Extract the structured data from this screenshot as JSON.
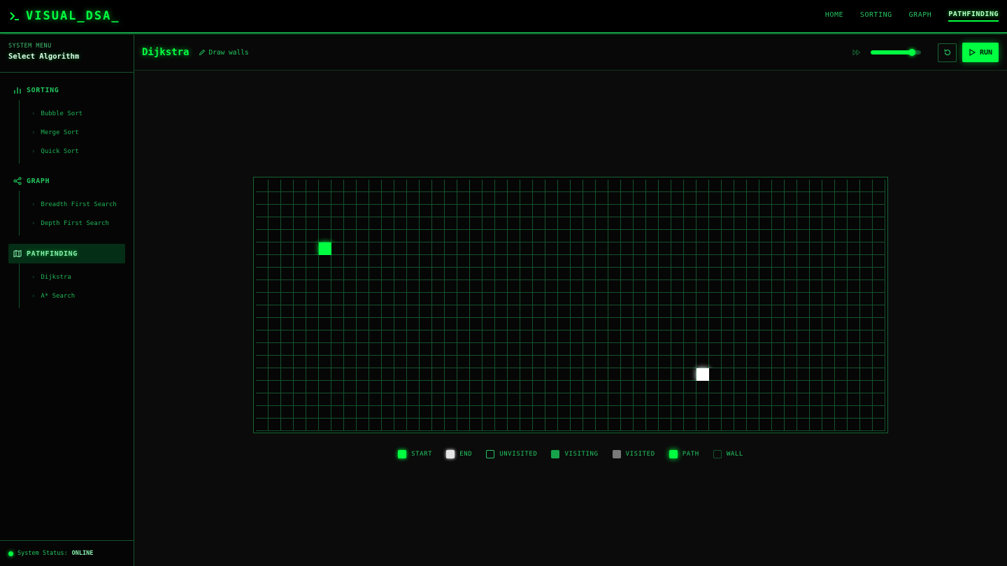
{
  "brand": {
    "text": "VISUAL_DSA_"
  },
  "topnav": [
    {
      "label": "HOME",
      "active": false
    },
    {
      "label": "SORTING",
      "active": false
    },
    {
      "label": "GRAPH",
      "active": false
    },
    {
      "label": "PATHFINDING",
      "active": true
    }
  ],
  "sidebar": {
    "small_label": "SYSTEM MENU",
    "title": "Select Algorithm",
    "categories": [
      {
        "label": "SORTING",
        "icon": "bar-chart-icon",
        "active": false,
        "items": [
          "Bubble Sort",
          "Merge Sort",
          "Quick Sort"
        ]
      },
      {
        "label": "GRAPH",
        "icon": "share-nodes-icon",
        "active": false,
        "items": [
          "Breadth First Search",
          "Depth First Search"
        ]
      },
      {
        "label": "PATHFINDING",
        "icon": "map-icon",
        "active": true,
        "items": [
          "Dijkstra",
          "A* Search"
        ]
      }
    ],
    "status_label": "System Status:",
    "status_value": "ONLINE"
  },
  "toolbar": {
    "algorithm_title": "Dijkstra",
    "draw_hint": "Draw walls",
    "speed_fraction": 0.82,
    "run_label": "RUN"
  },
  "grid": {
    "cols": 50,
    "rows": 20,
    "start": {
      "row": 5,
      "col": 5
    },
    "end": {
      "row": 15,
      "col": 35
    }
  },
  "legend": [
    {
      "key": "start",
      "label": "START"
    },
    {
      "key": "end",
      "label": "END"
    },
    {
      "key": "unvisited",
      "label": "UNVISITED"
    },
    {
      "key": "visiting",
      "label": "VISITING"
    },
    {
      "key": "visited",
      "label": "VISITED"
    },
    {
      "key": "path",
      "label": "PATH"
    },
    {
      "key": "wall",
      "label": "WALL"
    }
  ],
  "colors": {
    "accent": "#00ff41",
    "background": "#0a0a0a",
    "end_node": "#ffffff",
    "visited": "#7a7a7a"
  }
}
